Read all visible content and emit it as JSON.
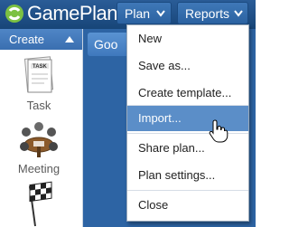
{
  "app": {
    "title": "GamePlan"
  },
  "nav": {
    "plan_label": "Plan",
    "reports_label": "Reports"
  },
  "sidebar": {
    "create_label": "Create",
    "tools": [
      {
        "label": "Task",
        "icon": "task-icon"
      },
      {
        "label": "Meeting",
        "icon": "meeting-icon"
      },
      {
        "label": "",
        "icon": "milestone-flag-icon"
      }
    ]
  },
  "main": {
    "tab_label": "Goo"
  },
  "menu": {
    "items": [
      {
        "label": "New"
      },
      {
        "label": "Save as..."
      },
      {
        "label": "Create template..."
      },
      {
        "label": "Import..."
      },
      {
        "label": "Share plan..."
      },
      {
        "label": "Plan settings..."
      },
      {
        "label": "Close"
      }
    ],
    "highlighted": "Import..."
  },
  "colors": {
    "topbar": "#1f4f86",
    "accent": "#3f78b8",
    "menu_highlight": "#5b8ec8",
    "main_background": "#2d64a4"
  }
}
